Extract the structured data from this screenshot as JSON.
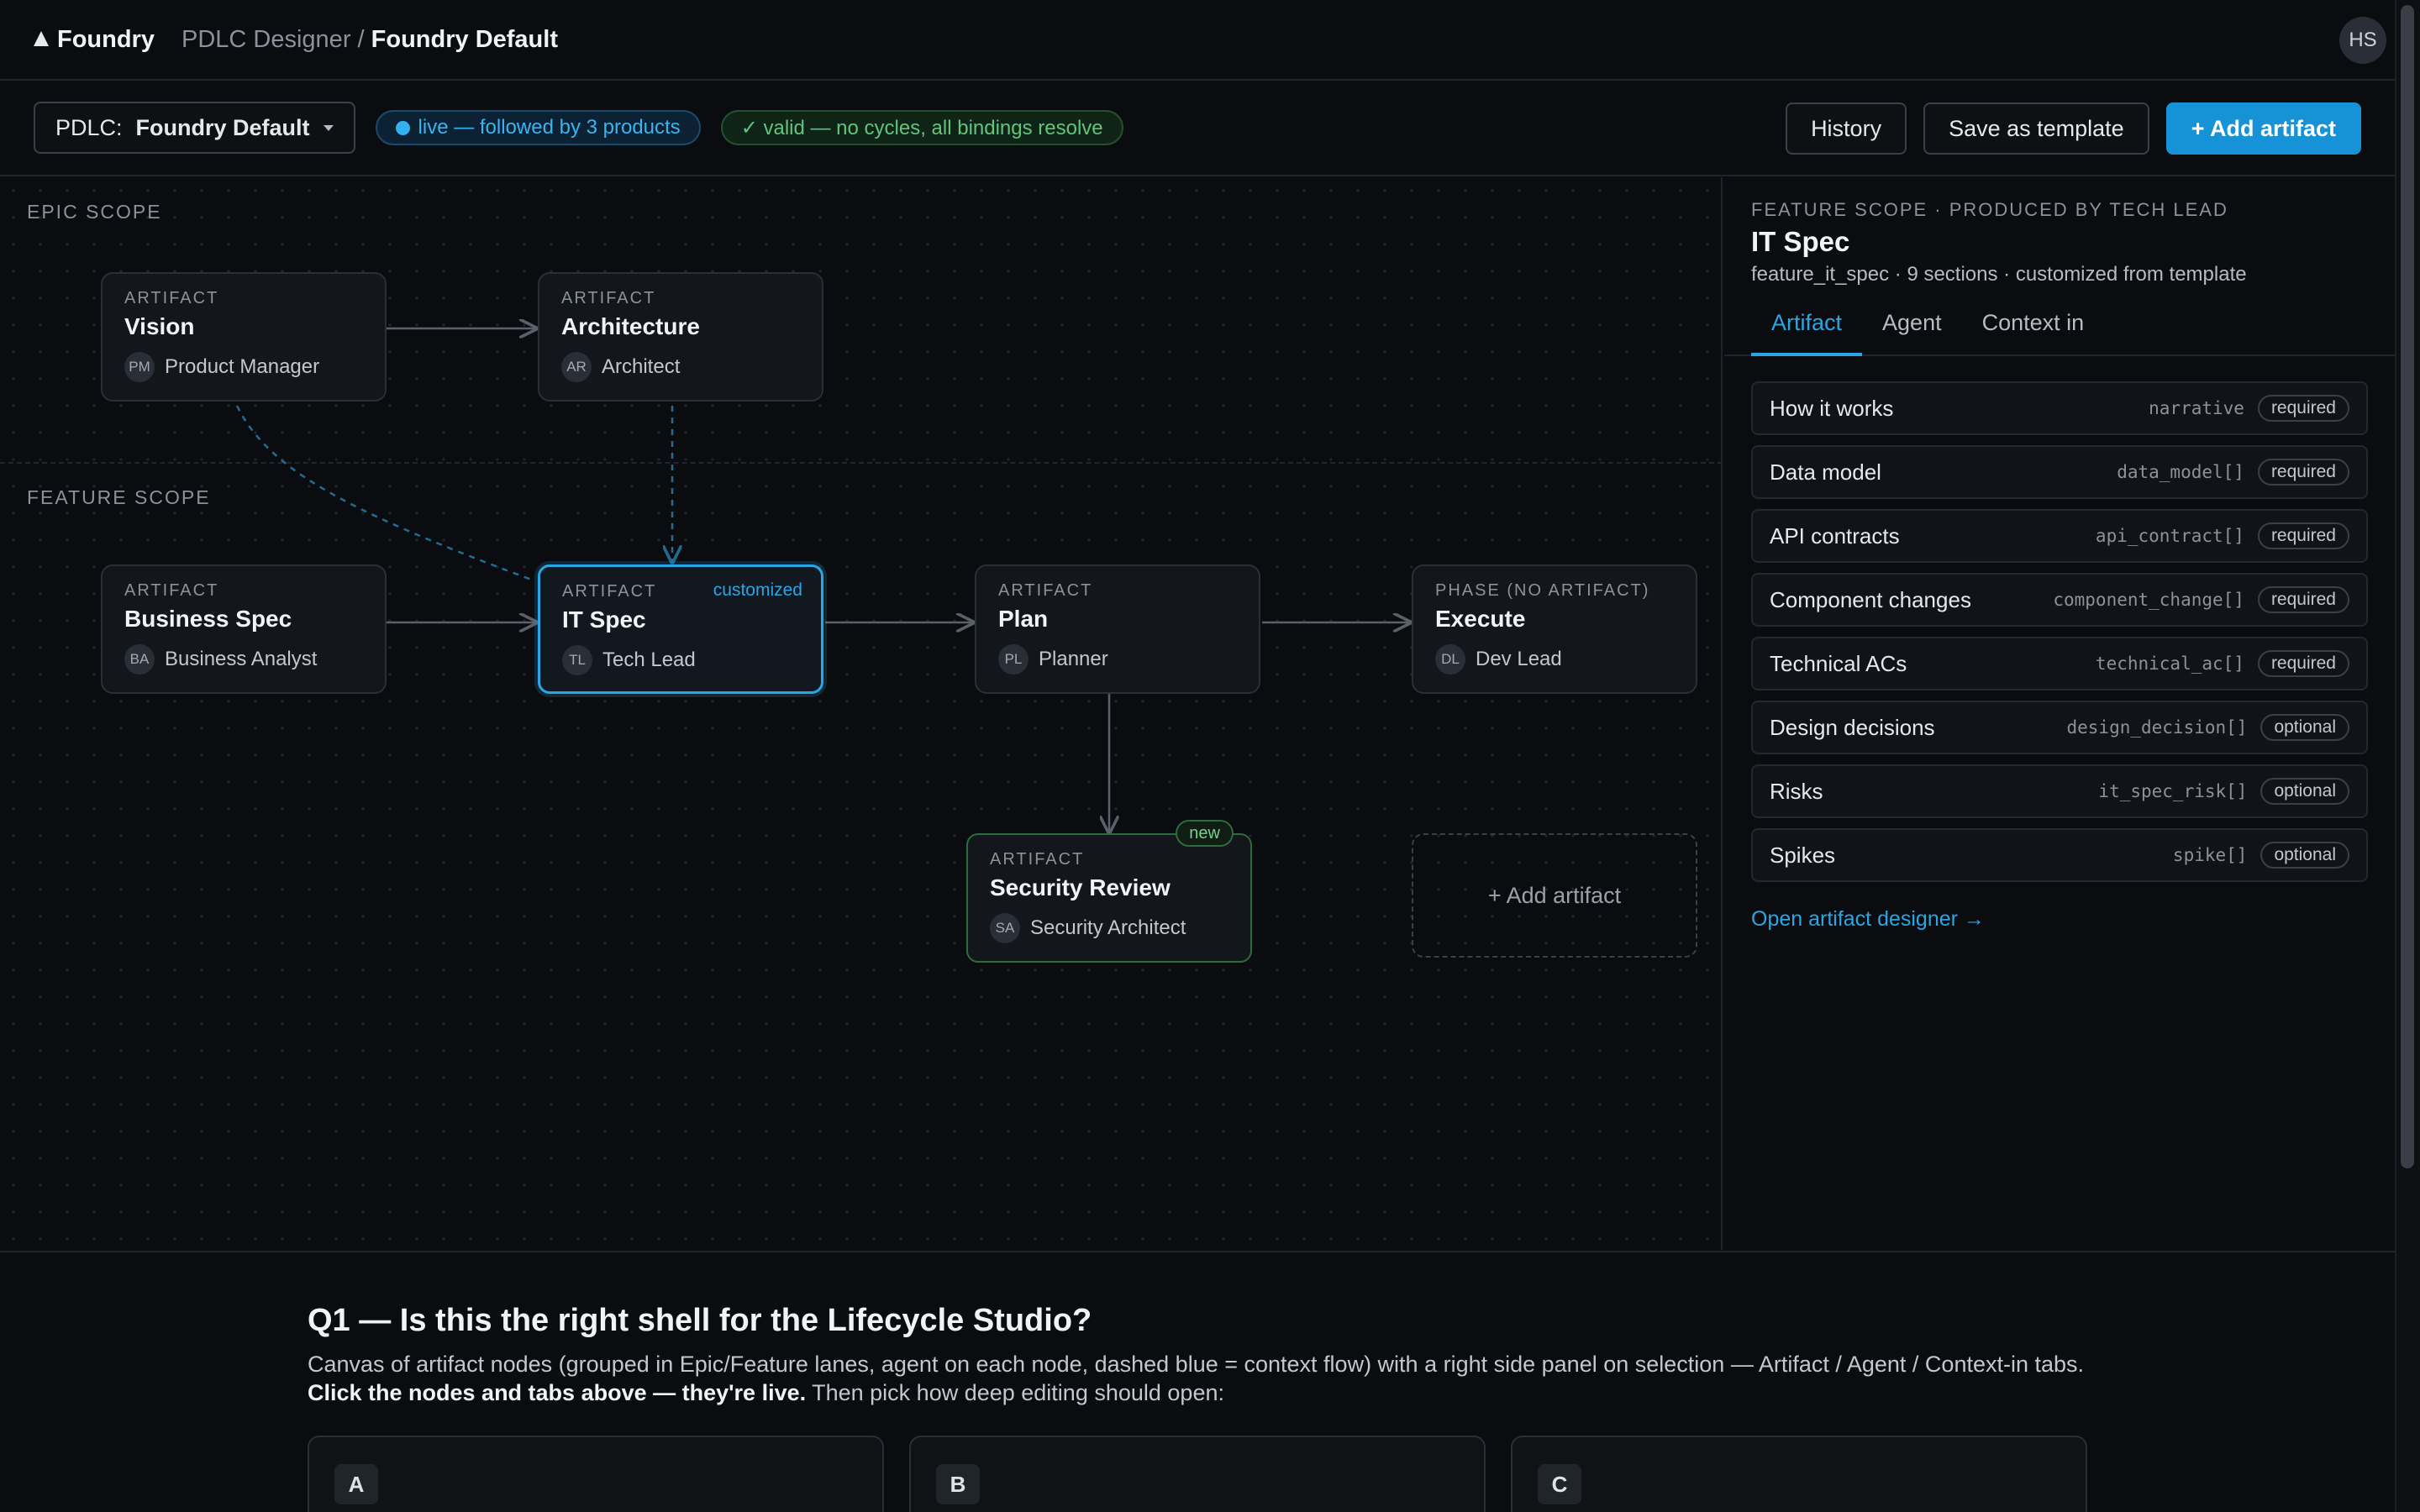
{
  "header": {
    "brand": "Foundry",
    "crumb_parent": "PDLC Designer",
    "crumb_sep": " / ",
    "crumb_current": "Foundry Default",
    "avatar": "HS"
  },
  "toolbar": {
    "pdlc_label": "PDLC:",
    "pdlc_value": "Foundry Default",
    "live_status": "live — followed by 3 products",
    "valid_status": "✓ valid — no cycles, all bindings resolve",
    "history": "History",
    "save_template": "Save as template",
    "add_artifact": "+ Add artifact"
  },
  "lanes": {
    "epic": "EPIC SCOPE",
    "feature": "FEATURE SCOPE"
  },
  "nodes": {
    "vision": {
      "kind": "ARTIFACT",
      "title": "Vision",
      "initials": "PM",
      "agent": "Product Manager"
    },
    "architecture": {
      "kind": "ARTIFACT",
      "title": "Architecture",
      "initials": "AR",
      "agent": "Architect"
    },
    "business_spec": {
      "kind": "ARTIFACT",
      "title": "Business Spec",
      "initials": "BA",
      "agent": "Business Analyst"
    },
    "it_spec": {
      "kind": "ARTIFACT",
      "title": "IT Spec",
      "initials": "TL",
      "agent": "Tech Lead",
      "tag": "customized"
    },
    "plan": {
      "kind": "ARTIFACT",
      "title": "Plan",
      "initials": "PL",
      "agent": "Planner"
    },
    "execute": {
      "kind": "PHASE (NO ARTIFACT)",
      "title": "Execute",
      "initials": "DL",
      "agent": "Dev Lead"
    },
    "security_review": {
      "kind": "ARTIFACT",
      "title": "Security Review",
      "initials": "SA",
      "agent": "Security Architect",
      "tag": "new"
    },
    "add": "+ Add artifact"
  },
  "panel": {
    "context": "FEATURE SCOPE · PRODUCED BY TECH LEAD",
    "title": "IT Spec",
    "meta": "feature_it_spec · 9 sections · customized from template",
    "tabs": [
      "Artifact",
      "Agent",
      "Context in"
    ],
    "sections": [
      {
        "name": "How it works",
        "type": "narrative",
        "req": "required"
      },
      {
        "name": "Data model",
        "type": "data_model[]",
        "req": "required"
      },
      {
        "name": "API contracts",
        "type": "api_contract[]",
        "req": "required"
      },
      {
        "name": "Component changes",
        "type": "component_change[]",
        "req": "required"
      },
      {
        "name": "Technical ACs",
        "type": "technical_ac[]",
        "req": "required"
      },
      {
        "name": "Design decisions",
        "type": "design_decision[]",
        "req": "optional"
      },
      {
        "name": "Risks",
        "type": "it_spec_risk[]",
        "req": "optional"
      },
      {
        "name": "Spikes",
        "type": "spike[]",
        "req": "optional"
      }
    ],
    "open_link": "Open artifact designer →"
  },
  "question": {
    "title": "Q1 — Is this the right shell for the Lifecycle Studio?",
    "desc_1": "Canvas of artifact nodes (grouped in Epic/Feature lanes, agent on each node, dashed blue = context flow) with a right side panel on selection — Artifact / Agent / Context-in tabs. ",
    "desc_bold": "Click the nodes and tabs above — they're live.",
    "desc_2": " Then pick how deep editing should open:",
    "options": [
      "A",
      "B",
      "C"
    ]
  },
  "colors": {
    "accent": "#2aa6e6",
    "primary_button": "#1593d6",
    "valid": "#62c47c",
    "new": "#79d08f"
  }
}
